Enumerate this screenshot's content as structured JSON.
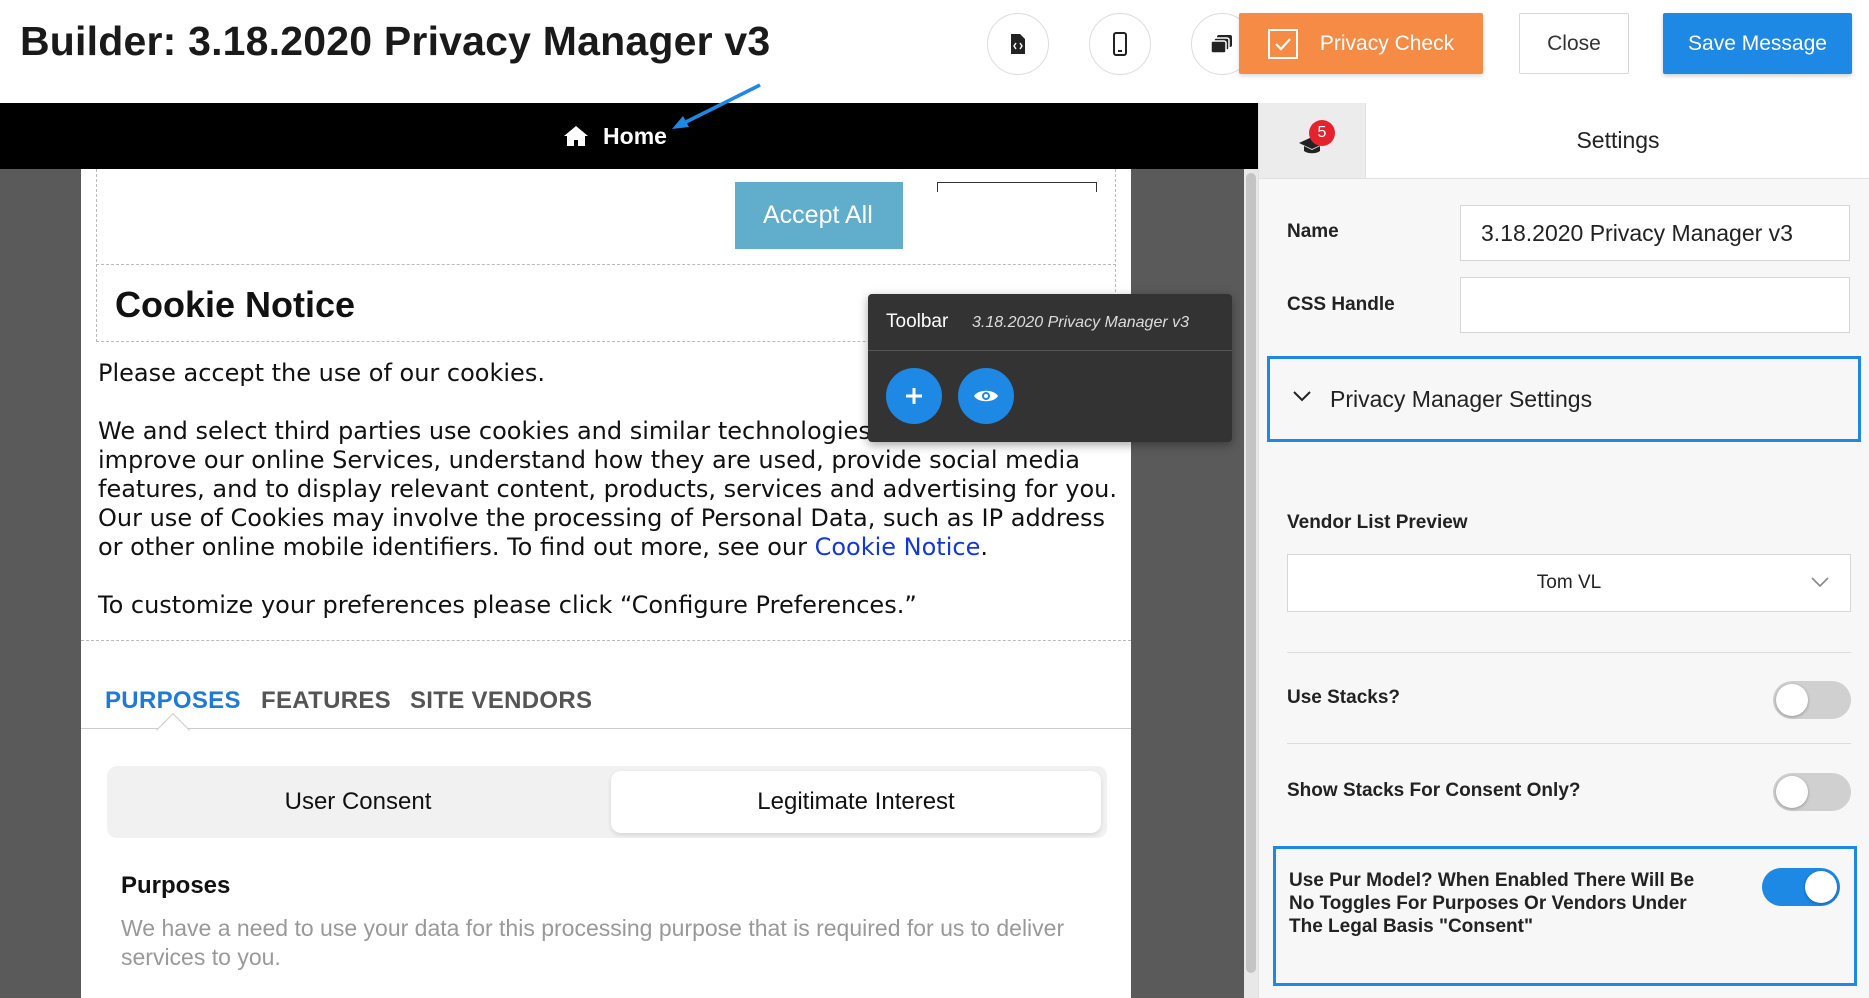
{
  "header": {
    "title": "Builder: 3.18.2020 Privacy Manager v3",
    "icon_buttons": [
      "code-file-icon",
      "mobile-icon",
      "layers-icon"
    ],
    "privacy_check_label": "Privacy Check",
    "close_label": "Close",
    "save_label": "Save Message"
  },
  "canvas": {
    "nav_label": "Home",
    "accept_label": "Accept All",
    "cookie_title": "Cookie Notice",
    "para1": "Please accept the use of our cookies.",
    "para2_before": "We and select third parties use cookies and similar technologies to deliver and improve our online Services, understand how they are used, provide social media features, and to display relevant content, products, services and advertising for you. Our use of Cookies may involve the processing of Personal Data, such as IP address or other online mobile identifiers. To find out more, see our ",
    "para2_link": "Cookie Notice",
    "para2_after": ".",
    "para3": "To customize your preferences please click “Configure Preferences.”",
    "tabs": [
      "PURPOSES",
      "FEATURES",
      "SITE VENDORS"
    ],
    "active_tab": "PURPOSES",
    "segment": {
      "left": "User Consent",
      "right": "Legitimate Interest",
      "selected": "Legitimate Interest"
    },
    "purposes_heading": "Purposes",
    "purposes_text": "We have a need to use your data for this processing purpose that is required for us to deliver services to you."
  },
  "toolbar": {
    "title": "Toolbar",
    "subtitle": "3.18.2020 Privacy Manager v3",
    "actions": [
      "plus-icon",
      "eye-icon"
    ]
  },
  "panel": {
    "badge_count": "5",
    "settings_tab": "Settings",
    "name_label": "Name",
    "name_value": "3.18.2020 Privacy Manager v3",
    "css_label": "CSS Handle",
    "css_value": "",
    "section_title": "Privacy Manager Settings",
    "vendor_label": "Vendor List Preview",
    "vendor_value": "Tom VL",
    "use_stacks_label": "Use Stacks?",
    "use_stacks_on": false,
    "show_stacks_label": "Show Stacks For Consent Only?",
    "show_stacks_on": false,
    "pur_model_label": "Use Pur Model? When Enabled There Will Be No Toggles For Purposes Or Vendors Under The Legal Basis \"Consent\"",
    "pur_model_on": true
  },
  "colors": {
    "accent": "#1e88e5",
    "orange": "#f58b45",
    "accept": "#60aecb",
    "badge": "#e5232e"
  }
}
